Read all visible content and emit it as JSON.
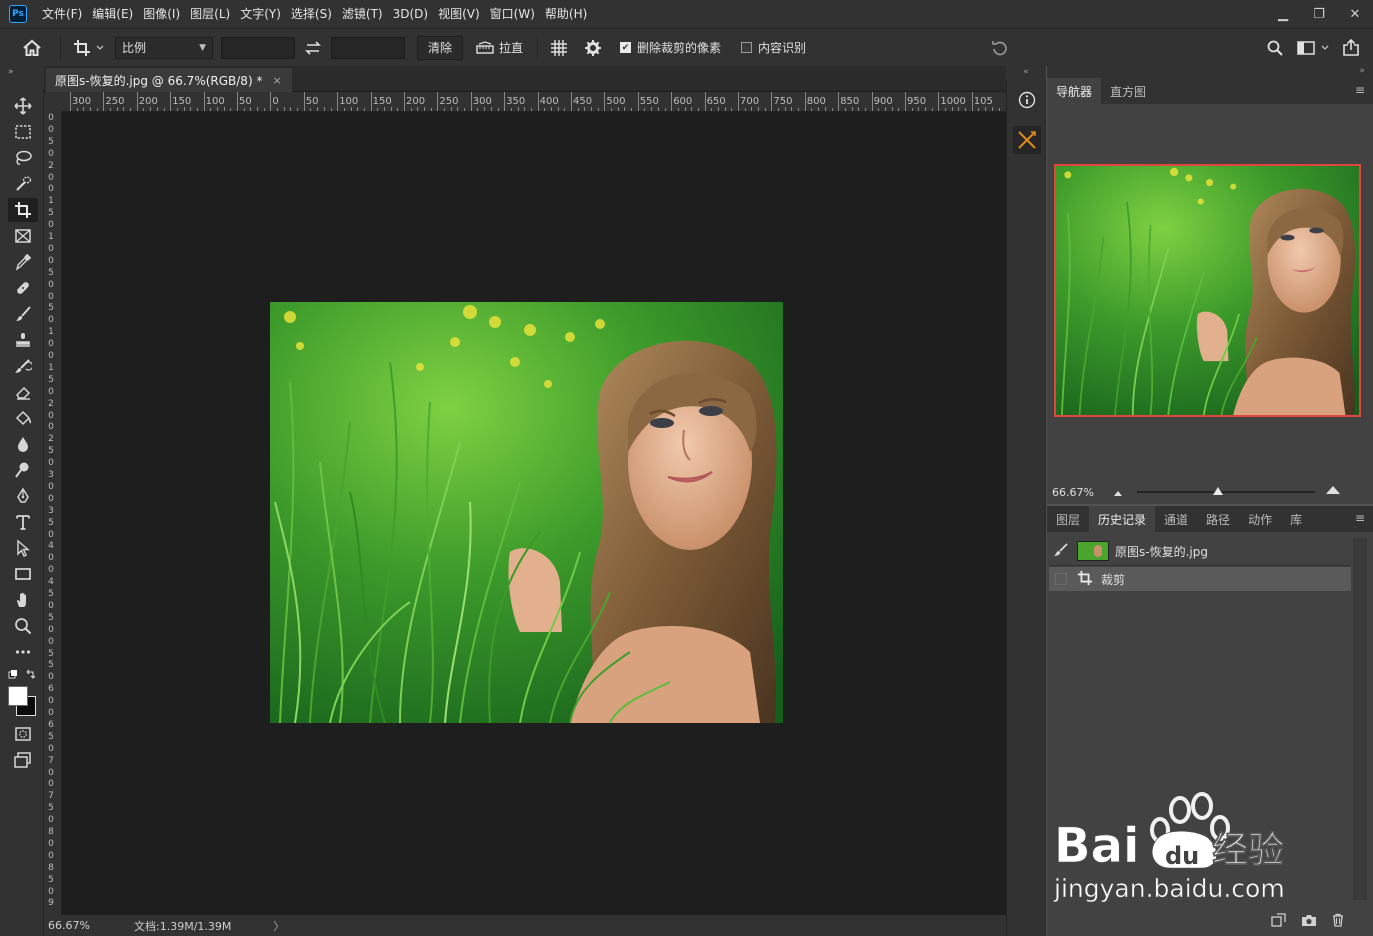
{
  "app": {
    "logo_text": "Ps"
  },
  "menu": [
    "文件(F)",
    "编辑(E)",
    "图像(I)",
    "图层(L)",
    "文字(Y)",
    "选择(S)",
    "滤镜(T)",
    "3D(D)",
    "视图(V)",
    "窗口(W)",
    "帮助(H)"
  ],
  "window_controls": {
    "minimize": "▁",
    "restore": "❐",
    "close": "✕"
  },
  "options": {
    "ratio_select": "比例",
    "clear_button": "清除",
    "straighten_label": "拉直",
    "delete_cropped_label": "删除裁剪的像素",
    "delete_cropped_checked": true,
    "content_aware_label": "内容识别",
    "content_aware_checked": false
  },
  "document": {
    "tab_title": "原图s-恢复的.jpg @ 66.7%(RGB/8) *",
    "close_glyph": "×"
  },
  "ruler_h_labels": [
    "300",
    "250",
    "200",
    "150",
    "100",
    "50",
    "0",
    "50",
    "100",
    "150",
    "200",
    "250",
    "300",
    "350",
    "400",
    "450",
    "500",
    "550",
    "600",
    "650",
    "700",
    "750",
    "800",
    "850",
    "900",
    "950",
    "1000",
    "105"
  ],
  "ruler_v_labels": [
    "0",
    "0",
    "5",
    "0",
    "2",
    "0",
    "0",
    "1",
    "5",
    "0",
    "1",
    "0",
    "0",
    "5",
    "0",
    "0",
    "5",
    "0",
    "1",
    "0",
    "0",
    "1",
    "5",
    "0",
    "2",
    "0",
    "0",
    "2",
    "5",
    "0",
    "3",
    "0",
    "0",
    "3",
    "5",
    "0",
    "4",
    "0",
    "0",
    "4",
    "5",
    "0",
    "5",
    "0",
    "0",
    "5",
    "5",
    "0",
    "6",
    "0",
    "0",
    "6",
    "5",
    "0",
    "7",
    "0",
    "0",
    "7",
    "5",
    "0",
    "8",
    "0",
    "0",
    "8",
    "5",
    "0",
    "9"
  ],
  "status": {
    "zoom": "66.67%",
    "doc_info": "文档:1.39M/1.39M",
    "arrow": "〉"
  },
  "navigator": {
    "tabs": [
      "导航器",
      "直方图"
    ],
    "active_tab": 0,
    "zoom": "66.67%"
  },
  "history_panel": {
    "tabs": [
      "图层",
      "历史记录",
      "通道",
      "路径",
      "动作",
      "库"
    ],
    "active_tab": 1,
    "snapshot_label": "原图s-恢复的.jpg",
    "steps": [
      {
        "label": "裁剪"
      }
    ]
  },
  "watermark": {
    "brand": "Bai",
    "brand_suffix": "经验",
    "url": "jingyan.baidu.com"
  }
}
